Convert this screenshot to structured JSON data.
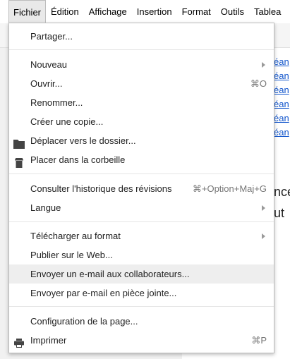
{
  "menubar": {
    "items": [
      "Fichier",
      "Édition",
      "Affichage",
      "Insertion",
      "Format",
      "Outils",
      "Tablea"
    ]
  },
  "background": {
    "links": [
      "éan",
      "éan",
      "éan",
      "éan",
      "éan",
      "éan"
    ],
    "text": [
      "nce",
      "ut"
    ]
  },
  "menu": {
    "share": "Partager...",
    "new": "Nouveau",
    "open": "Ouvrir...",
    "open_shortcut": "⌘O",
    "rename": "Renommer...",
    "copy": "Créer une copie...",
    "move": "Déplacer vers le dossier...",
    "trash": "Placer dans la corbeille",
    "history": "Consulter l'historique des révisions",
    "history_shortcut": "⌘+Option+Maj+G",
    "language": "Langue",
    "download": "Télécharger au format",
    "publish": "Publier sur le Web...",
    "email_collab": "Envoyer un e-mail aux collaborateurs...",
    "email_attach": "Envoyer par e-mail en pièce jointe...",
    "page_setup": "Configuration de la page...",
    "print": "Imprimer",
    "print_shortcut": "⌘P"
  },
  "icons": {
    "move": "folder-icon",
    "trash": "trash-icon",
    "print": "printer-icon",
    "submenu": "submenu-arrow-icon"
  }
}
